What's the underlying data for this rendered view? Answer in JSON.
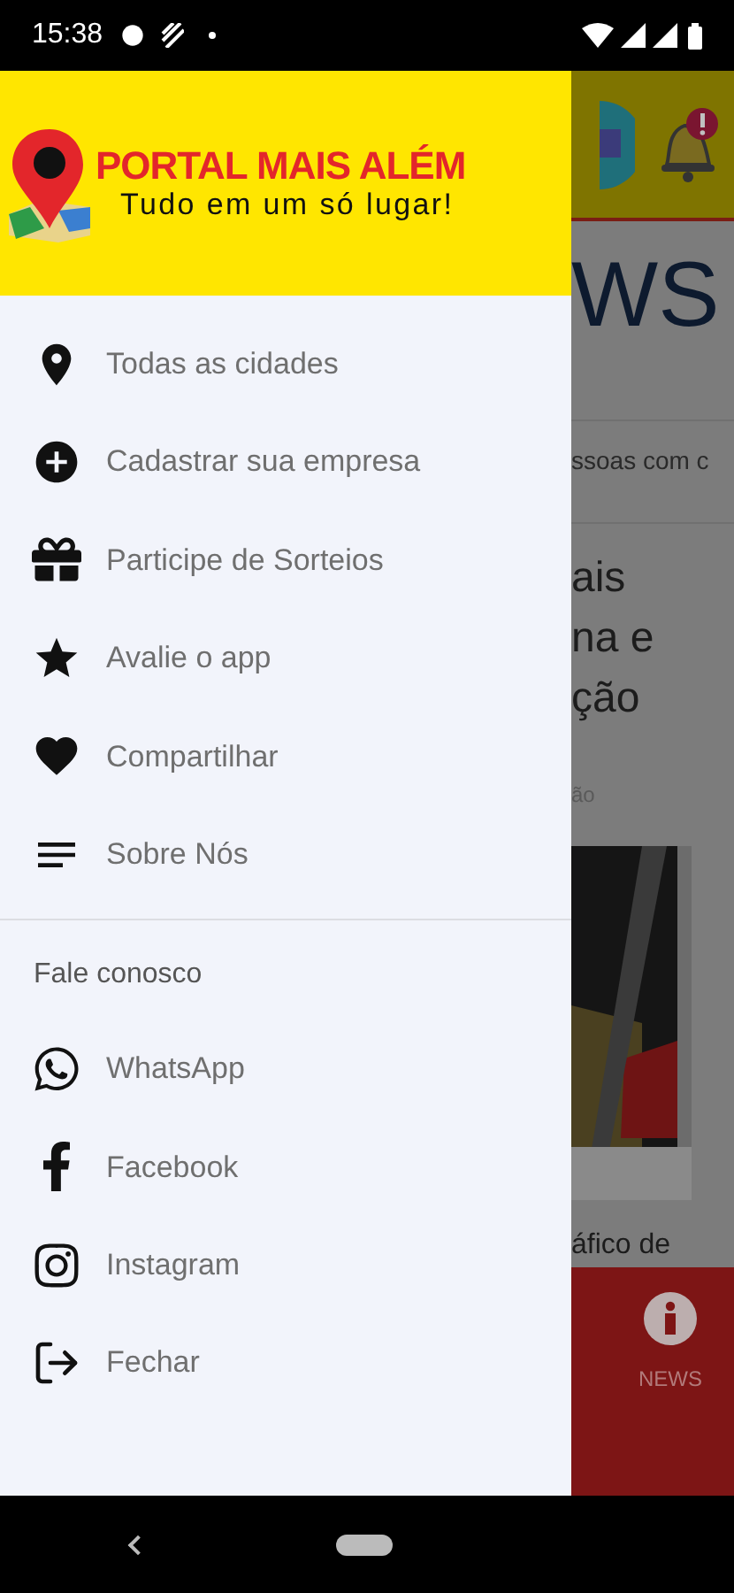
{
  "status_bar": {
    "time": "15:38"
  },
  "drawer": {
    "logo": {
      "title": "PORTAL MAIS ALÉM",
      "tagline": "Tudo em um só lugar!"
    },
    "items": [
      {
        "label": "Todas as cidades"
      },
      {
        "label": "Cadastrar sua empresa"
      },
      {
        "label": "Participe de Sorteios"
      },
      {
        "label": "Avalie o app"
      },
      {
        "label": "Compartilhar"
      },
      {
        "label": "Sobre Nós"
      }
    ],
    "contact_heading": "Fale conosco",
    "contacts": [
      {
        "label": "WhatsApp"
      },
      {
        "label": "Facebook"
      },
      {
        "label": "Instagram"
      },
      {
        "label": "Fechar"
      }
    ]
  },
  "background": {
    "heading": "WS",
    "subtitle": "ssoas com c",
    "article_title": [
      "ais",
      "na e",
      "ção"
    ],
    "article_meta": "ão",
    "caption": "áfico de",
    "nav": {
      "label": "NEWS"
    }
  }
}
